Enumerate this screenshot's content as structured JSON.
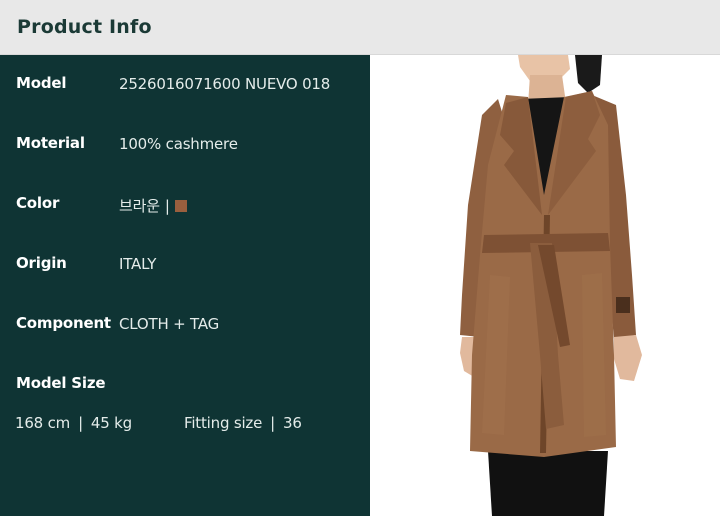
{
  "header": {
    "title": "Product Info"
  },
  "specs": [
    {
      "label": "Model",
      "value": "2526016071600 NUEVO 018"
    },
    {
      "label": "Moterial",
      "value": "100% cashmere"
    },
    {
      "label": "Color",
      "value": "브라운",
      "separator": "|",
      "swatch_color": "#9a5f3e"
    },
    {
      "label": "Origin",
      "value": "ITALY"
    },
    {
      "label": "Component",
      "value": "CLOTH + TAG"
    }
  ],
  "model_size": {
    "label": "Model Size",
    "height": "168 cm",
    "weight": "45 kg",
    "fitting_label": "Fitting size",
    "fitting_value": "36",
    "separator": "|"
  },
  "colors": {
    "header_bg": "#e8e8e8",
    "header_text": "#1b3a36",
    "panel_bg": "#0f3434",
    "coat": "#9a6a47"
  }
}
